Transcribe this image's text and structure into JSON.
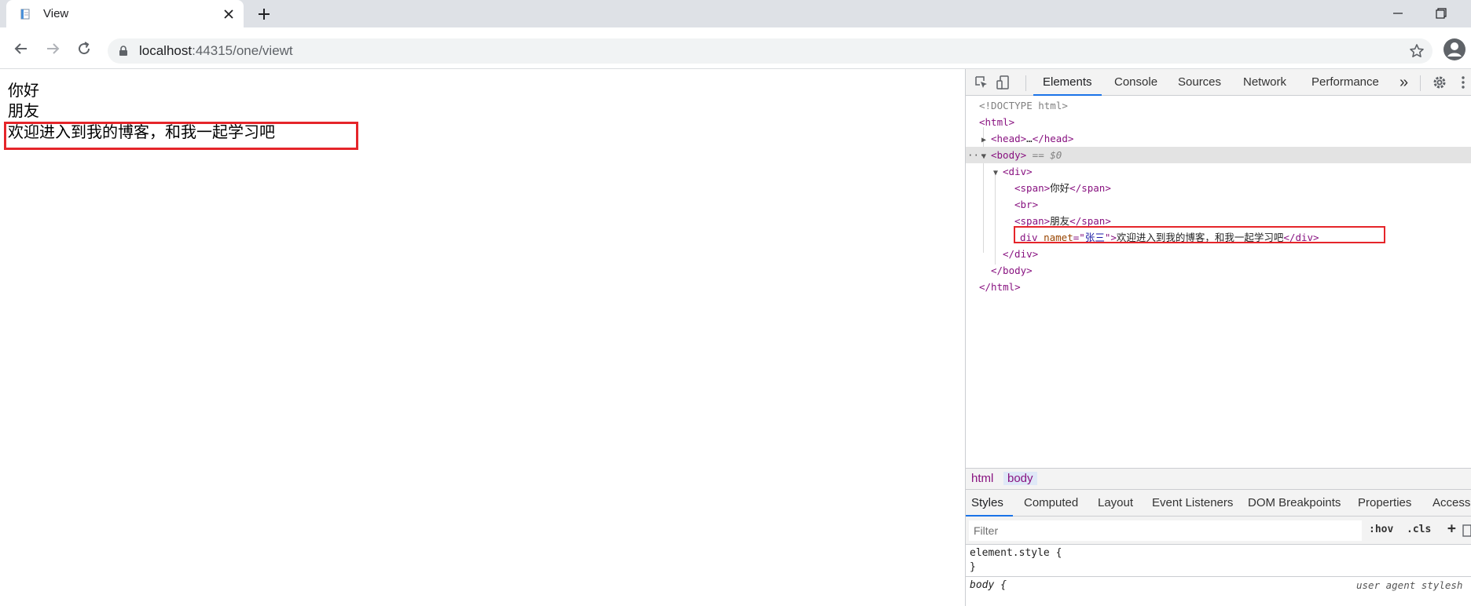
{
  "browser": {
    "tab_title": "View",
    "url_host": "localhost",
    "url_rest": ":44315/one/viewt"
  },
  "page": {
    "line1": "你好",
    "line2": "朋友",
    "line3": "欢迎进入到我的博客，和我一起学习吧"
  },
  "devtools": {
    "tabs": [
      "Elements",
      "Console",
      "Sources",
      "Network",
      "Performance"
    ],
    "more_tabs": "»",
    "dom": {
      "doctype": "<!DOCTYPE html>",
      "html_open": "<html>",
      "head_open": "<head>",
      "head_ellipsis": "…",
      "head_close": "</head>",
      "body_open": "<body>",
      "body_eq": " == $0",
      "div_open": "<div>",
      "span_open": "<span>",
      "span_close": "</span>",
      "span1_text": "你好",
      "br": "<br>",
      "span2_text": "朋友",
      "div_inner_tag": "div",
      "div_attr_name": "namet",
      "div_attr_eq": "=\"",
      "div_attr_value": "张三",
      "div_attr_close": "\">",
      "div_inner_text": "欢迎进入到我的博客，和我一起学习吧",
      "div_close": "</div>",
      "body_close": "</body>",
      "html_close": "</html>",
      "ellipsis_marker": "···"
    },
    "breadcrumbs": [
      "html",
      "body"
    ],
    "style_tabs": [
      "Styles",
      "Computed",
      "Layout",
      "Event Listeners",
      "DOM Breakpoints",
      "Properties",
      "Accessibili"
    ],
    "filter_placeholder": "Filter",
    "hov": ":hov",
    "cls": ".cls",
    "plus": "+",
    "rules": {
      "element_style": "element.style {",
      "close_brace": "}",
      "body_selector": "body {",
      "ua_label": "user agent stylesh"
    }
  },
  "colors": {
    "highlight": "#e5252a",
    "accent": "#1a73e8",
    "tag": "#881280",
    "attr_name": "#994500",
    "attr_value": "#1a1aa6"
  }
}
